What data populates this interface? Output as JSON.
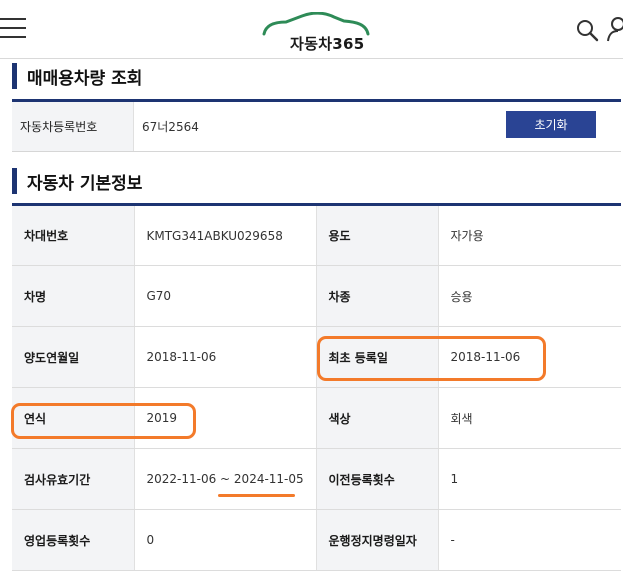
{
  "header": {
    "logo_text": "자동차365",
    "brand_color": "#2e8b57"
  },
  "search_section": {
    "title": "매매용차량 조회",
    "field_label": "자동차등록번호",
    "field_value": "67너2564",
    "reset_label": "초기화"
  },
  "info_section": {
    "title": "자동차 기본정보",
    "rows": [
      [
        {
          "label": "차대번호",
          "value": "KMTG341ABKU029658"
        },
        {
          "label": "용도",
          "value": "자가용"
        }
      ],
      [
        {
          "label": "차명",
          "value": "G70"
        },
        {
          "label": "차종",
          "value": "승용"
        }
      ],
      [
        {
          "label": "양도연월일",
          "value": "2018-11-06"
        },
        {
          "label": "최초 등록일",
          "value": "2018-11-06"
        }
      ],
      [
        {
          "label": "연식",
          "value": "2019"
        },
        {
          "label": "색상",
          "value": "회색"
        }
      ],
      [
        {
          "label": "검사유효기간",
          "value": "2022-11-06 ~ 2024-11-05"
        },
        {
          "label": "이전등록횟수",
          "value": "1"
        }
      ],
      [
        {
          "label": "영업등록횟수",
          "value": "0"
        },
        {
          "label": "운행정지명령일자",
          "value": "-"
        }
      ]
    ]
  },
  "colors": {
    "accent_navy": "#1d3472",
    "button_blue": "#2a4494",
    "annotation_orange": "#f37a2a"
  }
}
